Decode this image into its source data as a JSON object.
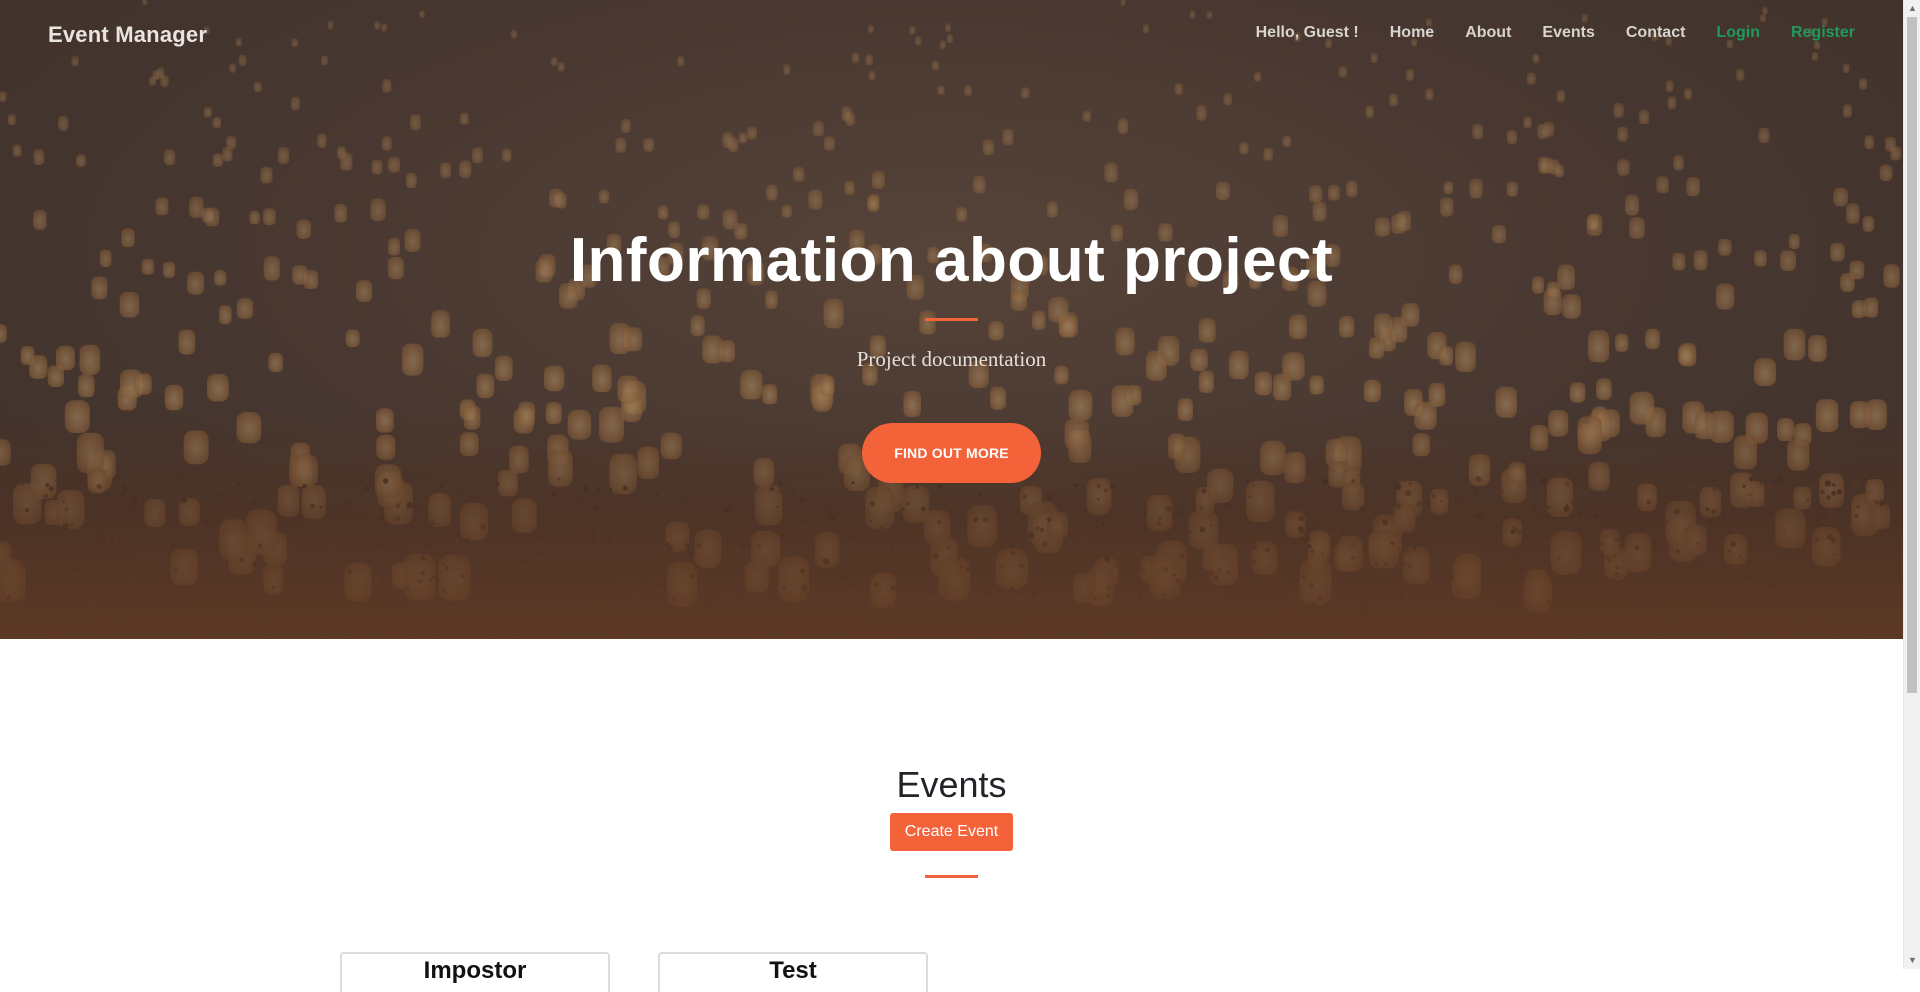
{
  "navbar": {
    "brand": "Event Manager",
    "greeting": "Hello, Guest !",
    "links": [
      "Home",
      "About",
      "Events",
      "Contact"
    ],
    "login": "Login",
    "register": "Register"
  },
  "hero": {
    "title": "Information about project",
    "subtitle": "Project documentation",
    "button": "FIND OUT MORE"
  },
  "events": {
    "heading": "Events",
    "create_button": "Create Event",
    "cards": [
      {
        "title": "Impostor"
      },
      {
        "title": "Test"
      }
    ]
  },
  "colors": {
    "accent": "#f4623a",
    "auth_link": "#1f9a5c"
  },
  "icons": {
    "scroll_up": "triangle-up-icon",
    "scroll_down": "triangle-down-icon"
  }
}
